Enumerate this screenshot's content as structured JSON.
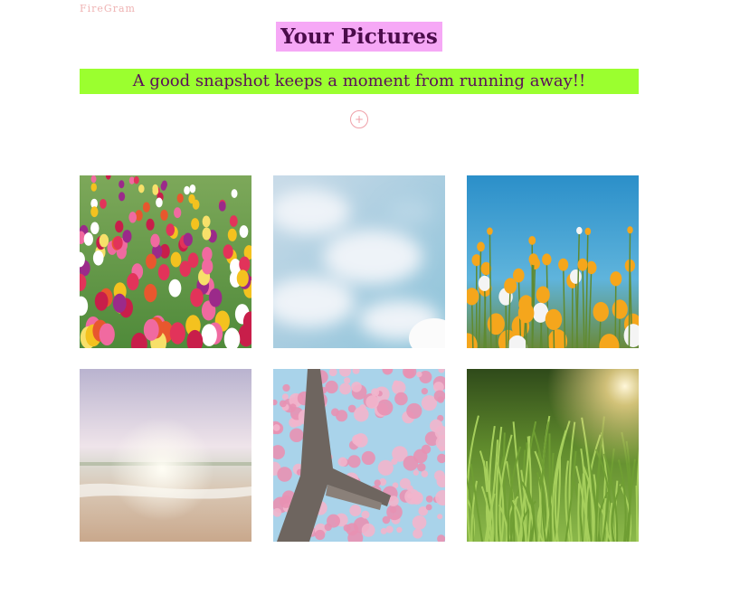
{
  "brand": "FireGram",
  "title": "Your Pictures",
  "tagline": "A good snapshot keeps a moment from running away!!",
  "upload": {
    "icon": "plus-icon",
    "glyph": "+"
  },
  "colors": {
    "title_bg": "#f6a8f6",
    "title_text": "#4b0c4b",
    "tagline_bg": "#9bff2f",
    "tagline_text": "#5a0f5a",
    "brand": "#efb3b3",
    "accent": "#efa0a8"
  },
  "photos": [
    {
      "subject": "tulip-field"
    },
    {
      "subject": "clouds-sky"
    },
    {
      "subject": "orange-poppies"
    },
    {
      "subject": "beach-sunset"
    },
    {
      "subject": "cherry-blossoms"
    },
    {
      "subject": "sunlit-grass"
    }
  ]
}
